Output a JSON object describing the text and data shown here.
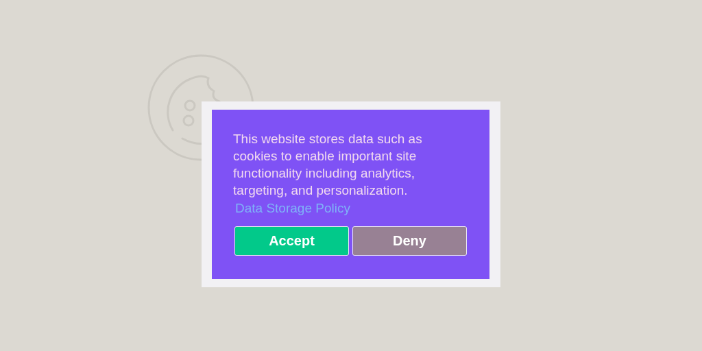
{
  "banner": {
    "message": "This website stores data such as cookies to enable important site functionality including analytics, targeting, and personalization.",
    "link": "Data Storage Policy",
    "buttons": [
      {
        "label": "Accept",
        "kind": "accept"
      },
      {
        "label": "Deny",
        "kind": "deny"
      }
    ]
  }
}
